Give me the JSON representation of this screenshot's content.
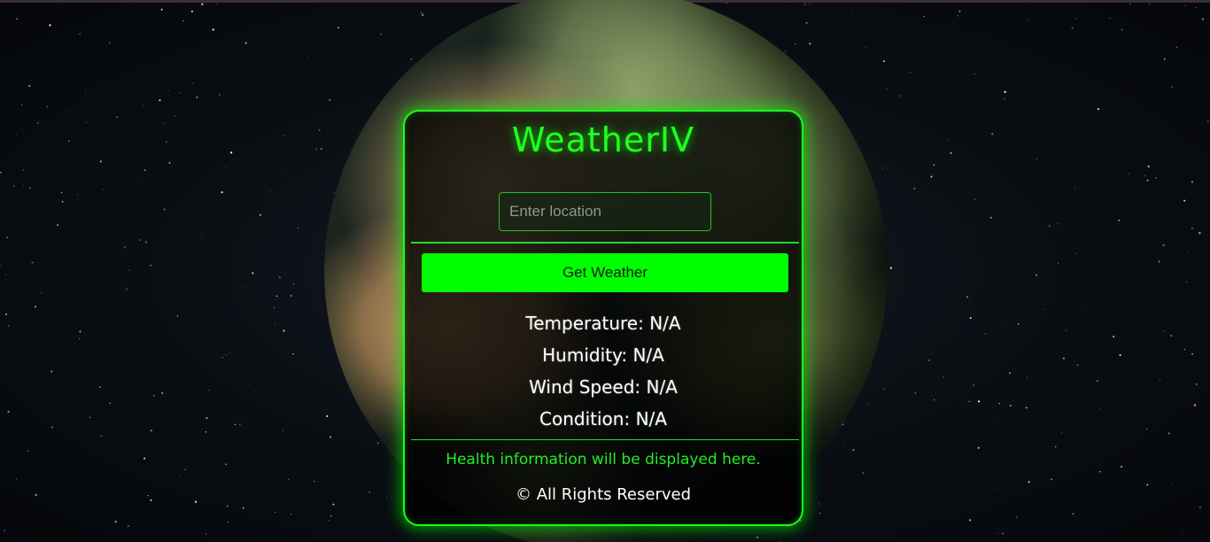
{
  "app": {
    "title": "WeatherIV"
  },
  "search": {
    "placeholder": "Enter location",
    "value": ""
  },
  "actions": {
    "get_weather_label": "Get Weather"
  },
  "readings": {
    "temperature": "Temperature: N/A",
    "humidity": "Humidity: N/A",
    "wind_speed": "Wind Speed: N/A",
    "condition": "Condition: N/A"
  },
  "health": {
    "message": "Health information will be displayed here."
  },
  "footer": {
    "text": "© All Rights Reserved"
  },
  "colors": {
    "accent": "#00ff00",
    "card_border": "#1aff1a",
    "text": "#ffffff",
    "background": "#05070b"
  }
}
